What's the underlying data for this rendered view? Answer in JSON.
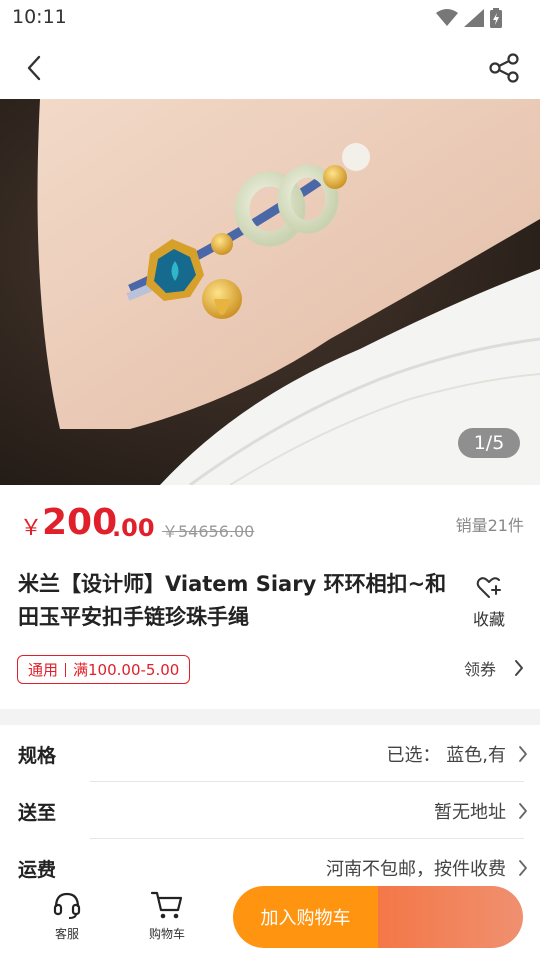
{
  "status": {
    "time": "10:11",
    "icons": [
      "wifi-icon",
      "signal-icon",
      "battery-icon"
    ]
  },
  "nav": {
    "back_icon": "chevron-left-icon",
    "share_icon": "share-icon"
  },
  "gallery": {
    "counter": "1/5"
  },
  "price": {
    "symbol": "￥",
    "integer": "200",
    "decimal": ".00",
    "original": "￥54656.00",
    "sales": "销量21件"
  },
  "product": {
    "title": "米兰【设计师】Viatem Siary 环环相扣~和田玉平安扣手链珍珠手绳",
    "favorite_label": "收藏"
  },
  "coupon": {
    "scope": "通用",
    "rule": "满100.00-5.00",
    "get_label": "领券"
  },
  "specs": [
    {
      "label": "规格",
      "value": "已选：  蓝色,有"
    },
    {
      "label": "送至",
      "value": "暂无地址"
    },
    {
      "label": "运费",
      "value": "河南不包邮，按件收费"
    }
  ],
  "bottom": {
    "service_label": "客服",
    "cart_label": "购物车",
    "add_to_cart": "加入购物车",
    "buy_now": ""
  },
  "colors": {
    "price_red": "#e0202a",
    "cta_orange": "#ff9410",
    "cta_coral": "#f47747"
  }
}
